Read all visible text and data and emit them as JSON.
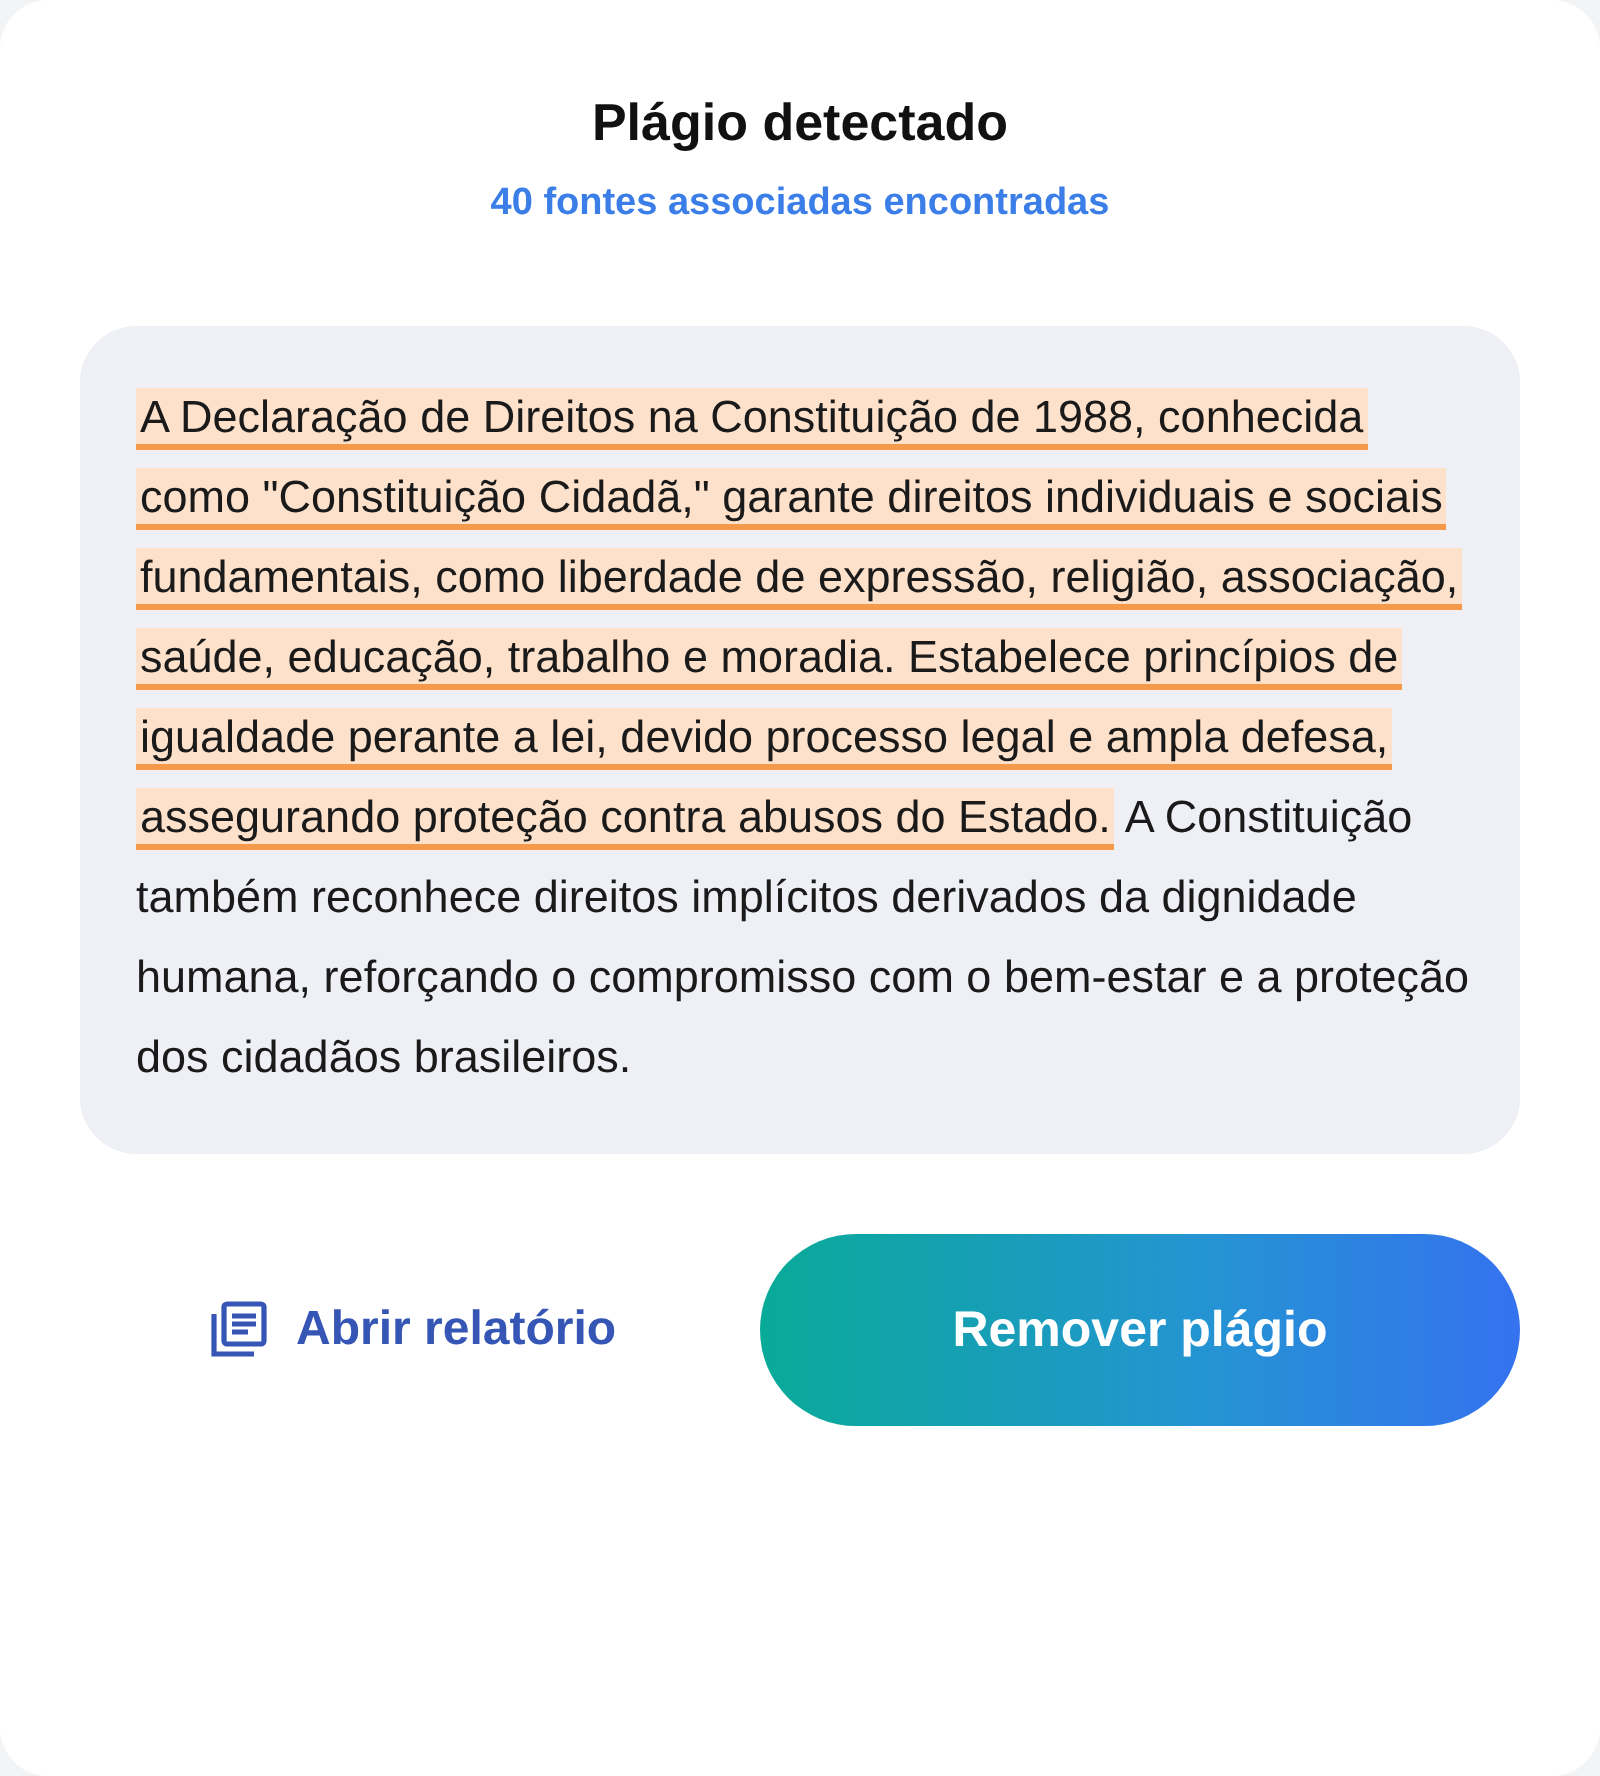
{
  "title": "Plágio detectado",
  "subtitle": "40 fontes associadas encontradas",
  "passage": {
    "highlighted": "A Declaração de Direitos na Constituição de 1988, conhecida como \"Constituição Cidadã,\" garante direitos individuais e sociais fundamentais, como liberdade de expressão, religião, associação, saúde, educação, trabalho e moradia. Estabelece princípios de igualdade perante a lei, devido processo legal e ampla defesa, assegurando proteção contra abusos do Estado.",
    "rest": " A Constituição também reconhece direitos implícitos derivados da dignidade humana, reforçando o compromisso com o bem-estar e a proteção dos cidadãos brasileiros."
  },
  "actions": {
    "report_link": "Abrir relatório",
    "primary_button": "Remover plágio"
  }
}
